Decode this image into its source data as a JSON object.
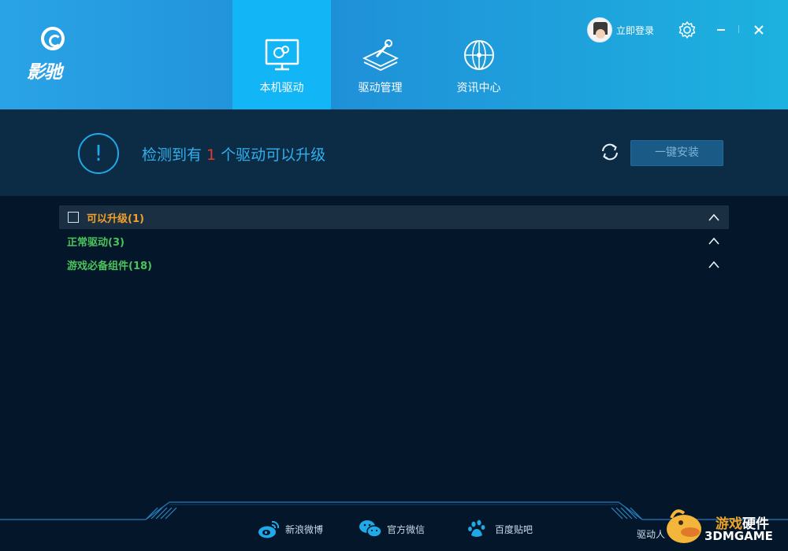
{
  "app": {
    "logo_text": "影驰"
  },
  "tabs": [
    {
      "label": "本机驱动",
      "icon": "monitor-icon",
      "active": true
    },
    {
      "label": "驱动管理",
      "icon": "wrench-board-icon",
      "active": false
    },
    {
      "label": "资讯中心",
      "icon": "globe-icon",
      "active": false
    }
  ],
  "user": {
    "login_label": "立即登录"
  },
  "status": {
    "prefix": "检测到有",
    "count": "1",
    "suffix": "个驱动可以升级",
    "install_label": "一键安装"
  },
  "groups": [
    {
      "label": "可以升级(1)",
      "color": "#f1a12a",
      "has_checkbox": true
    },
    {
      "label": "正常驱动(3)",
      "color": "#4bc35b",
      "has_checkbox": false
    },
    {
      "label": "游戏必备组件(18)",
      "color": "#4bc35b",
      "has_checkbox": false
    }
  ],
  "footer": {
    "social": [
      {
        "label": "新浪微博",
        "icon": "weibo-icon"
      },
      {
        "label": "官方微信",
        "icon": "wechat-icon"
      },
      {
        "label": "百度贴吧",
        "icon": "baidu-paw-icon"
      }
    ],
    "version_label": "驱动人"
  },
  "watermark": {
    "line1_orange": "游戏",
    "line1_white": "硬件",
    "line2": "3DMGAME"
  },
  "colors": {
    "accent": "#1fa9e8",
    "active_tab": "#12b5f5",
    "warning": "#e23a2e",
    "upgrade": "#f1a12a",
    "normal": "#4bc35b"
  }
}
